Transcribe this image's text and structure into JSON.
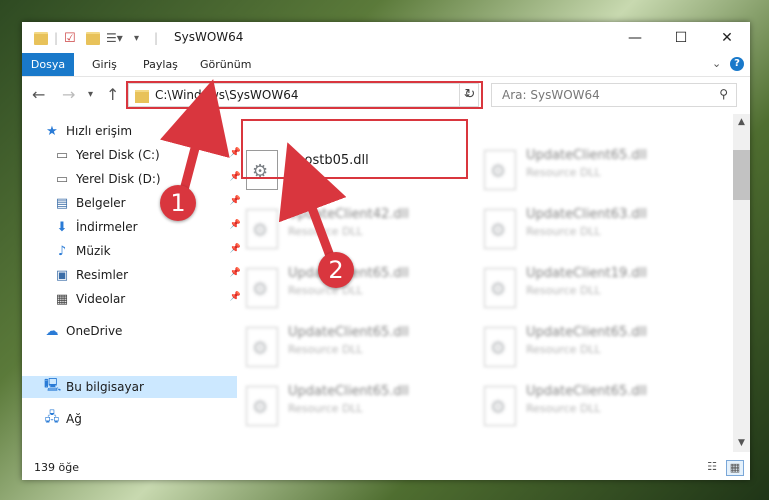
{
  "window": {
    "title": "SysWOW64"
  },
  "ribbon": {
    "tabs": [
      "Dosya",
      "Giriş",
      "Paylaş",
      "Görünüm"
    ]
  },
  "address": {
    "path": "C:\\Windows\\SysWOW64"
  },
  "search": {
    "placeholder": "Ara: SysWOW64"
  },
  "nav": {
    "items": [
      {
        "label": "Hızlı erişim",
        "icon": "star-icon"
      },
      {
        "label": "Yerel Disk (C:)",
        "icon": "drive-icon"
      },
      {
        "label": "Yerel Disk (D:)",
        "icon": "drive-icon"
      },
      {
        "label": "Belgeler",
        "icon": "documents-icon"
      },
      {
        "label": "İndirmeler",
        "icon": "downloads-icon"
      },
      {
        "label": "Müzik",
        "icon": "music-icon"
      },
      {
        "label": "Resimler",
        "icon": "pictures-icon"
      },
      {
        "label": "Videolar",
        "icon": "videos-icon"
      },
      {
        "label": "OneDrive",
        "icon": "cloud-icon"
      },
      {
        "label": "Bu bilgisayar",
        "icon": "computer-icon"
      },
      {
        "label": "Ağ",
        "icon": "network-icon"
      }
    ]
  },
  "files": [
    {
      "name": "hpostb05.dll",
      "type": ""
    },
    {
      "name": "UpdateClient65.dll",
      "type": "Resource DLL"
    },
    {
      "name": "UpdateClient42.dll",
      "type": "Resource DLL"
    },
    {
      "name": "UpdateClient63.dll",
      "type": "Resource DLL"
    },
    {
      "name": "UpdateClient65.dll",
      "type": "Resource DLL"
    },
    {
      "name": "UpdateClient19.dll",
      "type": "Resource DLL"
    },
    {
      "name": "UpdateClient65.dll",
      "type": "Resource DLL"
    },
    {
      "name": "UpdateClient65.dll",
      "type": "Resource DLL"
    },
    {
      "name": "UpdateClient65.dll",
      "type": "Resource DLL"
    },
    {
      "name": "UpdateClient65.dll",
      "type": "Resource DLL"
    }
  ],
  "status": {
    "count": "139 öğe"
  },
  "annotations": {
    "step1": "1",
    "step2": "2"
  },
  "colors": {
    "accent": "#1979ca",
    "highlight": "#d9363e",
    "selection": "#cce8ff"
  }
}
